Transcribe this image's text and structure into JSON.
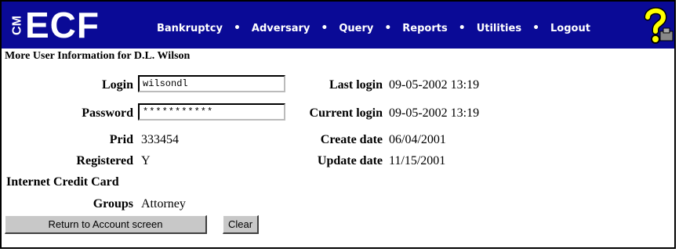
{
  "app": {
    "logo_cm": "CM",
    "logo_ecf": "ECF"
  },
  "nav": {
    "items": [
      "Bankruptcy",
      "Adversary",
      "Query",
      "Reports",
      "Utilities",
      "Logout"
    ],
    "separator": "•"
  },
  "page": {
    "title": "More User Information for D.L. Wilson"
  },
  "form": {
    "login_label": "Login",
    "login_value": "wilsondl",
    "password_label": "Password",
    "password_value": "***********",
    "prid_label": "Prid",
    "prid_value": "333454",
    "registered_label": "Registered",
    "registered_value": "Y",
    "internet_credit_card_label": "Internet Credit Card",
    "groups_label": "Groups",
    "groups_value": "Attorney",
    "last_login_label": "Last login",
    "last_login_value": "09-05-2002 13:19",
    "current_login_label": "Current login",
    "current_login_value": "09-05-2002 13:19",
    "create_date_label": "Create date",
    "create_date_value": "06/04/2001",
    "update_date_label": "Update date",
    "update_date_value": "11/15/2001"
  },
  "buttons": {
    "return_label": "Return to Account screen",
    "clear_label": "Clear"
  },
  "colors": {
    "nav_bg": "#0a0a96",
    "help_icon": "#ffff00"
  }
}
